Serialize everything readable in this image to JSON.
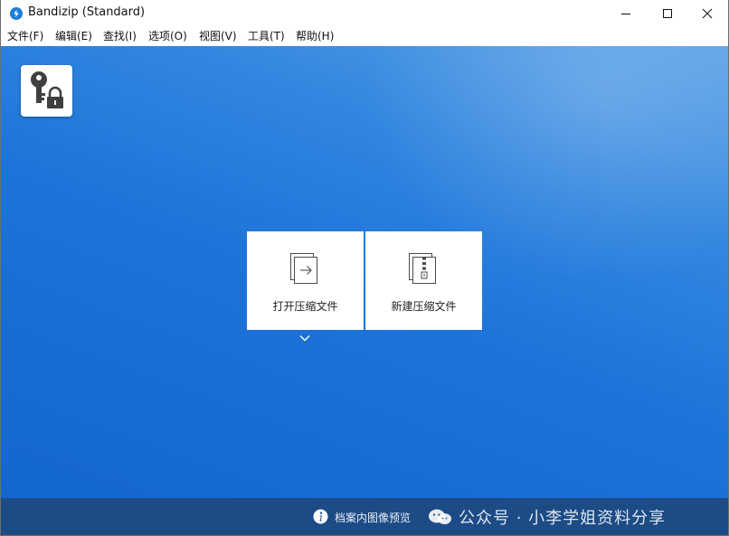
{
  "window": {
    "title": "Bandizip (Standard)",
    "controls": [
      "minimize",
      "maximize",
      "close"
    ]
  },
  "menu": [
    {
      "label": "文件(F)"
    },
    {
      "label": "编辑(E)"
    },
    {
      "label": "查找(I)"
    },
    {
      "label": "选项(O)"
    },
    {
      "label": "视图(V)"
    },
    {
      "label": "工具(T)"
    },
    {
      "label": "帮助(H)"
    }
  ],
  "main": {
    "password_tile_icon": "key-lock-icon",
    "actions": [
      {
        "label": "打开压缩文件",
        "icon": "open-archive-icon"
      },
      {
        "label": "新建压缩文件",
        "icon": "new-archive-icon"
      }
    ],
    "more_icon": "chevron-down-icon",
    "background_colors": [
      "#5aa3e6",
      "#1466cf"
    ]
  },
  "statusbar": {
    "preview_label": "档案内图像预览",
    "watermark": "公众号 · 小李学姐资料分享"
  }
}
